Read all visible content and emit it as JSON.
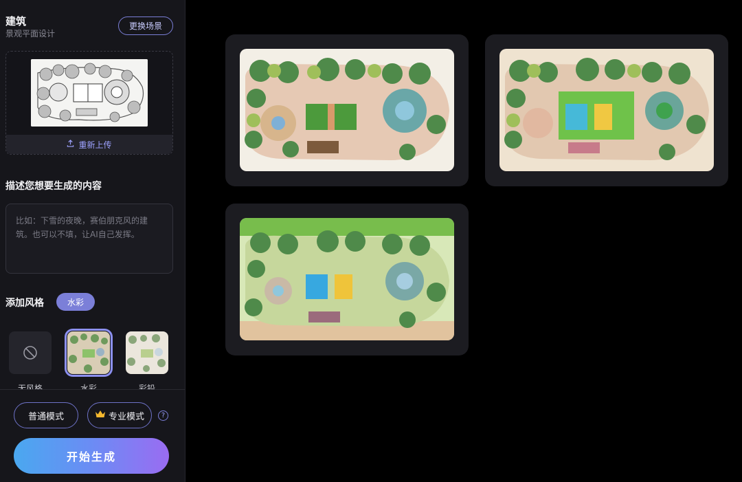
{
  "scene": {
    "title": "建筑",
    "subtitle": "景观平面设计",
    "change_button": "更换场景"
  },
  "upload": {
    "reupload_label": "重新上传",
    "icon": "upload-icon"
  },
  "prompt": {
    "heading": "描述您想要生成的内容",
    "placeholder": "比如：下雪的夜晚，赛伯朋克风的建筑。也可以不填，让AI自己发挥。"
  },
  "style": {
    "heading": "添加风格",
    "selected_tag": "水彩",
    "options": [
      {
        "label": "无风格",
        "icon": "no-style-icon"
      },
      {
        "label": "水彩"
      },
      {
        "label": "彩铅"
      }
    ]
  },
  "modes": {
    "normal": "普通模式",
    "pro": "专业模式",
    "pro_icon": "crown-icon",
    "help": "?"
  },
  "start_button": "开始生成",
  "colors": {
    "accent": "#7b7fd8",
    "gradient_start": "#4aa8f0",
    "gradient_end": "#9a6cf2"
  },
  "results": [
    {
      "variant": "watercolor-pink"
    },
    {
      "variant": "watercolor-cream"
    },
    {
      "variant": "watercolor-green"
    }
  ]
}
